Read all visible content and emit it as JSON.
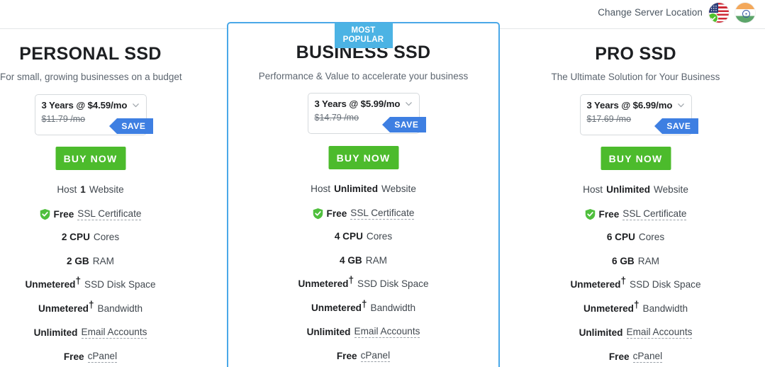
{
  "topbar": {
    "server_location_label": "Change Server Location",
    "flags": [
      {
        "name": "united-states",
        "selected": true,
        "check_icon": "check-icon"
      },
      {
        "name": "india",
        "selected": false
      }
    ]
  },
  "plans": [
    {
      "id": "personal-ssd",
      "title": "PERSONAL SSD",
      "subtitle": "For small, growing businesses on a budget",
      "featured": false,
      "price": {
        "term_label": "3 Years @ $4.59/mo",
        "old_price": "$11.79 /mo",
        "save_label": "SAVE",
        "chevron_icon": "chevron-down-icon"
      },
      "buy_label": "BUY NOW",
      "features": [
        {
          "pre": "Host ",
          "strong": "1",
          "post": " Website"
        },
        {
          "icon": "shield-check-icon",
          "strong": "Free",
          "post": "SSL Certificate",
          "post_dotted": true
        },
        {
          "strong": "2 CPU",
          "post": " Cores"
        },
        {
          "strong": "2 GB",
          "post": " RAM"
        },
        {
          "strong": "Unmetered",
          "dagger": true,
          "post": " SSD Disk Space"
        },
        {
          "strong": "Unmetered",
          "dagger": true,
          "post": " Bandwidth"
        },
        {
          "strong": "Unlimited",
          "post": "Email Accounts",
          "post_dotted": true
        },
        {
          "strong": "Free",
          "post": "cPanel",
          "post_dotted": true
        }
      ]
    },
    {
      "id": "business-ssd",
      "title": "BUSINESS SSD",
      "subtitle": "Performance & Value to accelerate your business",
      "featured": true,
      "badge": "MOST POPULAR",
      "price": {
        "term_label": "3 Years @ $5.99/mo",
        "old_price": "$14.79 /mo",
        "save_label": "SAVE",
        "chevron_icon": "chevron-down-icon"
      },
      "buy_label": "BUY NOW",
      "features": [
        {
          "pre": "Host ",
          "strong": "Unlimited",
          "post": " Website"
        },
        {
          "icon": "shield-check-icon",
          "strong": "Free",
          "post": "SSL Certificate",
          "post_dotted": true
        },
        {
          "strong": "4 CPU",
          "post": " Cores"
        },
        {
          "strong": "4 GB",
          "post": " RAM"
        },
        {
          "strong": "Unmetered",
          "dagger": true,
          "post": " SSD Disk Space"
        },
        {
          "strong": "Unmetered",
          "dagger": true,
          "post": " Bandwidth"
        },
        {
          "strong": "Unlimited",
          "post": "Email Accounts",
          "post_dotted": true
        },
        {
          "strong": "Free",
          "post": "cPanel",
          "post_dotted": true
        }
      ]
    },
    {
      "id": "pro-ssd",
      "title": "PRO SSD",
      "subtitle": "The Ultimate Solution for Your Business",
      "featured": false,
      "price": {
        "term_label": "3 Years @ $6.99/mo",
        "old_price": "$17.69 /mo",
        "save_label": "SAVE",
        "chevron_icon": "chevron-down-icon"
      },
      "buy_label": "BUY NOW",
      "features": [
        {
          "pre": "Host ",
          "strong": "Unlimited",
          "post": " Website"
        },
        {
          "icon": "shield-check-icon",
          "strong": "Free",
          "post": "SSL Certificate",
          "post_dotted": true
        },
        {
          "strong": "6 CPU",
          "post": " Cores"
        },
        {
          "strong": "6 GB",
          "post": " RAM"
        },
        {
          "strong": "Unmetered",
          "dagger": true,
          "post": " SSD Disk Space"
        },
        {
          "strong": "Unmetered",
          "dagger": true,
          "post": " Bandwidth"
        },
        {
          "strong": "Unlimited",
          "post": "Email Accounts",
          "post_dotted": true
        },
        {
          "strong": "Free",
          "post": "cPanel",
          "post_dotted": true
        }
      ]
    }
  ],
  "colors": {
    "accent_blue": "#4aa8e8",
    "badge_blue": "#4cb3e4",
    "save_blue": "#3e7fe2",
    "buy_green": "#4cbb2c",
    "shield_green": "#4fbf3d",
    "text_dark": "#1d1f22",
    "text_muted": "#5d6670"
  }
}
